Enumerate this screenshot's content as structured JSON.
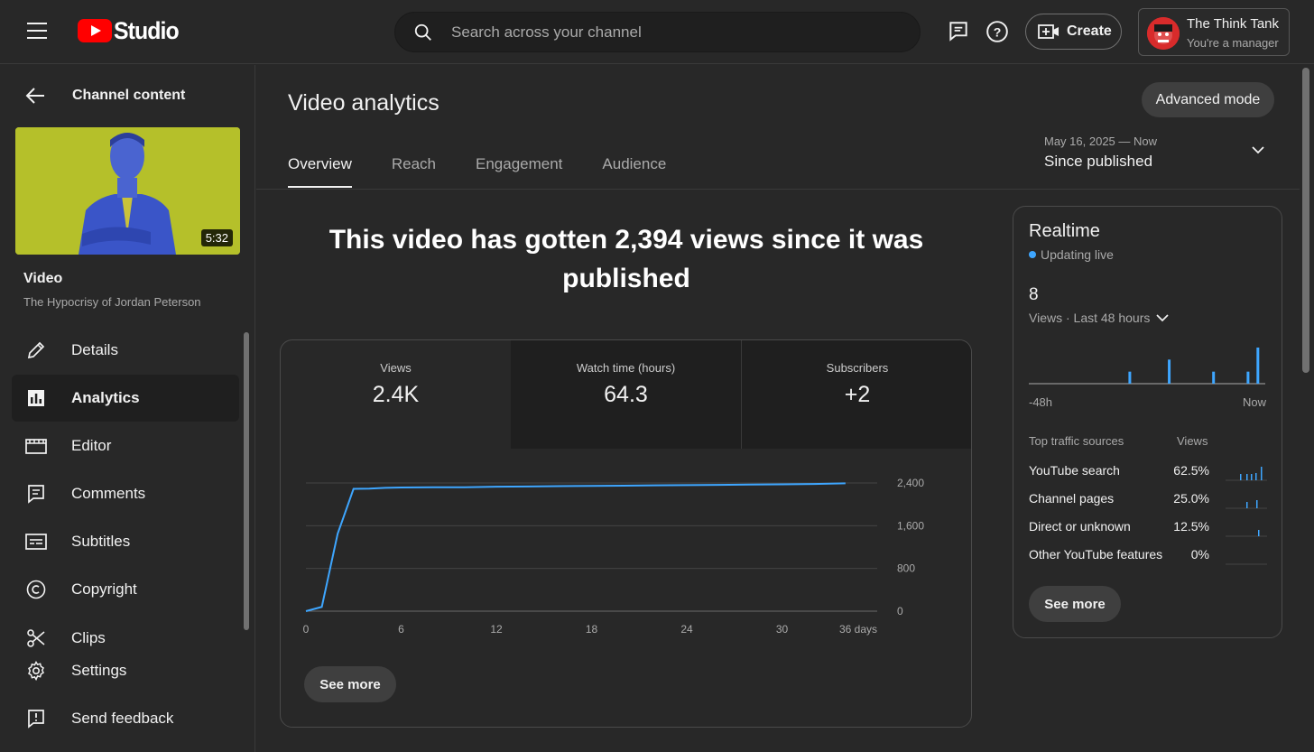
{
  "topbar": {
    "logo_text": "Studio",
    "search_placeholder": "Search across your channel",
    "create_label": "Create",
    "account_name": "The Think Tank",
    "account_role": "You're a manager"
  },
  "sidebar": {
    "back_label": "Channel content",
    "thumbnail_duration": "5:32",
    "video_label": "Video",
    "video_title": "The Hypocrisy of Jordan Peterson",
    "items": [
      {
        "label": "Details",
        "icon": "pencil-icon"
      },
      {
        "label": "Analytics",
        "icon": "analytics-icon",
        "active": true
      },
      {
        "label": "Editor",
        "icon": "clapperboard-icon"
      },
      {
        "label": "Comments",
        "icon": "comment-icon"
      },
      {
        "label": "Subtitles",
        "icon": "subtitles-icon"
      },
      {
        "label": "Copyright",
        "icon": "copyright-icon"
      },
      {
        "label": "Clips",
        "icon": "scissors-icon"
      },
      {
        "label": "Settings",
        "icon": "gear-icon"
      },
      {
        "label": "Send feedback",
        "icon": "feedback-icon"
      }
    ]
  },
  "main": {
    "title": "Video analytics",
    "advanced_mode_label": "Advanced mode",
    "tabs": [
      {
        "label": "Overview",
        "active": true
      },
      {
        "label": "Reach"
      },
      {
        "label": "Engagement"
      },
      {
        "label": "Audience"
      }
    ],
    "date_range_dates": "May 16, 2025 — Now",
    "date_range_label": "Since published",
    "headline": "This video has gotten 2,394 views since it was published"
  },
  "overview_card": {
    "metrics": [
      {
        "label": "Views",
        "value": "2.4K"
      },
      {
        "label": "Watch time (hours)",
        "value": "64.3"
      },
      {
        "label": "Subscribers",
        "value": "+2"
      }
    ],
    "see_more_label": "See more"
  },
  "chart_data": {
    "type": "line",
    "series": [
      {
        "name": "Views",
        "x": [
          0,
          1,
          2,
          3,
          4,
          5,
          6,
          8,
          10,
          12,
          14,
          16,
          18,
          20,
          22,
          24,
          26,
          28,
          30,
          32,
          34
        ],
        "values": [
          0,
          80,
          1450,
          2290,
          2295,
          2310,
          2315,
          2320,
          2320,
          2330,
          2335,
          2340,
          2345,
          2350,
          2355,
          2360,
          2365,
          2370,
          2375,
          2380,
          2394
        ]
      }
    ],
    "xticks": [
      "0",
      "6",
      "12",
      "18",
      "24",
      "30",
      "36 days"
    ],
    "yticks": [
      "2,400",
      "1,600",
      "800",
      "0"
    ],
    "xlim": [
      0,
      36
    ],
    "ylim": [
      0,
      2400
    ],
    "line_color": "#3ea6ff"
  },
  "realtime": {
    "title": "Realtime",
    "live_label": "Updating live",
    "count": "8",
    "period_label": "Views · Last 48 hours",
    "axis_start": "-48h",
    "axis_end": "Now",
    "bar_values": [
      0,
      0,
      0,
      0,
      0,
      0,
      0,
      0,
      0,
      0,
      0,
      0,
      0,
      0,
      0,
      0,
      0,
      0,
      0,
      0,
      1,
      0,
      0,
      0,
      0,
      0,
      0,
      0,
      2,
      0,
      0,
      0,
      0,
      0,
      0,
      0,
      0,
      1,
      0,
      0,
      0,
      0,
      0,
      0,
      1,
      0,
      3,
      0
    ],
    "traffic_header_source": "Top traffic sources",
    "traffic_header_views": "Views",
    "traffic": [
      {
        "source": "YouTube search",
        "pct": "62.5%"
      },
      {
        "source": "Channel pages",
        "pct": "25.0%"
      },
      {
        "source": "Direct or unknown",
        "pct": "12.5%"
      },
      {
        "source": "Other YouTube features",
        "pct": "0%"
      }
    ],
    "see_more_label": "See more"
  }
}
